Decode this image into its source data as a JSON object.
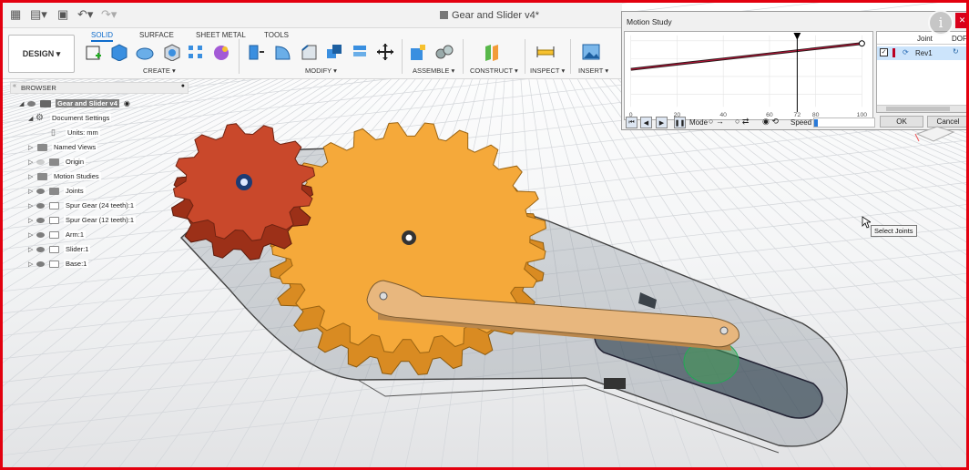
{
  "window": {
    "title": "Gear and Slider v4*"
  },
  "workspace": {
    "label": "DESIGN ▾"
  },
  "tabs": [
    "SOLID",
    "SURFACE",
    "SHEET METAL",
    "TOOLS"
  ],
  "groups": [
    "CREATE ▾",
    "MODIFY ▾",
    "ASSEMBLE ▾",
    "CONSTRUCT ▾",
    "INSPECT ▾",
    "INSERT ▾"
  ],
  "browser": {
    "title": "BROWSER",
    "items": [
      {
        "label": "Gear and Slider v4"
      },
      {
        "label": "Document Settings"
      },
      {
        "label": "Units: mm"
      },
      {
        "label": "Named Views"
      },
      {
        "label": "Origin"
      },
      {
        "label": "Motion Studies"
      },
      {
        "label": "Joints"
      },
      {
        "label": "Spur Gear (24 teeth):1"
      },
      {
        "label": "Spur Gear (12 teeth):1"
      },
      {
        "label": "Arm:1"
      },
      {
        "label": "Slider:1"
      },
      {
        "label": "Base:1"
      }
    ]
  },
  "motion_study": {
    "title": "Motion Study",
    "x_ticks": [
      "0",
      "20",
      "40",
      "60",
      "72",
      "80",
      "100"
    ],
    "playhead": 72,
    "col_joint": "Joint",
    "col_dof": "DOF",
    "joint_name": "Rev1",
    "mode_label": "Mode",
    "speed_label": "Speed",
    "ok": "OK",
    "cancel": "Cancel"
  },
  "tooltip": "Select Joints",
  "colors": {
    "accent": "#0f6ccc",
    "frame": "#e3000f",
    "large_gear": "#f5a93a",
    "small_gear": "#c9482b",
    "arm": "#e8b77e"
  }
}
